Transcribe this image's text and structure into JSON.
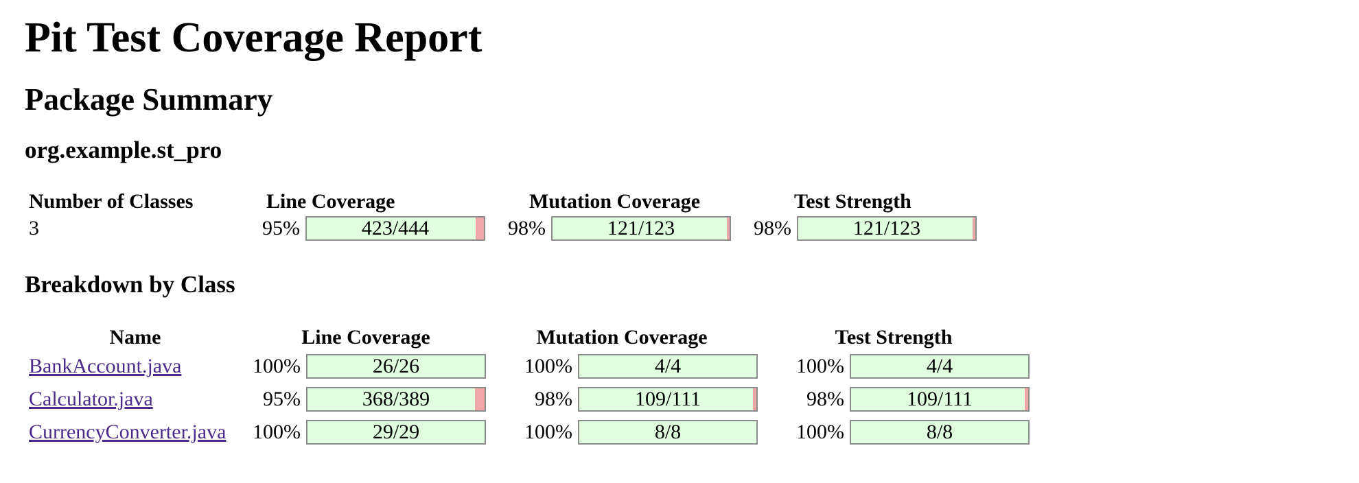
{
  "title": "Pit Test Coverage Report",
  "package_summary_heading": "Package Summary",
  "package_name": "org.example.st_pro",
  "summary": {
    "headers": {
      "classes": "Number of Classes",
      "line": "Line Coverage",
      "mutation": "Mutation Coverage",
      "strength": "Test Strength"
    },
    "classes": "3",
    "line": {
      "pct": "95%",
      "text": "423/444",
      "fraction": 0.953
    },
    "mutation": {
      "pct": "98%",
      "text": "121/123",
      "fraction": 0.984
    },
    "strength": {
      "pct": "98%",
      "text": "121/123",
      "fraction": 0.984
    }
  },
  "breakdown_heading": "Breakdown by Class",
  "breakdown": {
    "headers": {
      "name": "Name",
      "line": "Line Coverage",
      "mutation": "Mutation Coverage",
      "strength": "Test Strength"
    },
    "rows": [
      {
        "name": "BankAccount.java",
        "line": {
          "pct": "100%",
          "text": "26/26",
          "fraction": 1.0
        },
        "mutation": {
          "pct": "100%",
          "text": "4/4",
          "fraction": 1.0
        },
        "strength": {
          "pct": "100%",
          "text": "4/4",
          "fraction": 1.0
        }
      },
      {
        "name": "Calculator.java",
        "line": {
          "pct": "95%",
          "text": "368/389",
          "fraction": 0.946
        },
        "mutation": {
          "pct": "98%",
          "text": "109/111",
          "fraction": 0.982
        },
        "strength": {
          "pct": "98%",
          "text": "109/111",
          "fraction": 0.982
        }
      },
      {
        "name": "CurrencyConverter.java",
        "line": {
          "pct": "100%",
          "text": "29/29",
          "fraction": 1.0
        },
        "mutation": {
          "pct": "100%",
          "text": "8/8",
          "fraction": 1.0
        },
        "strength": {
          "pct": "100%",
          "text": "8/8",
          "fraction": 1.0
        }
      }
    ]
  },
  "colors": {
    "covered": "#dfffdf",
    "missed": "#f1a7a7",
    "link": "#4a2b8c"
  }
}
